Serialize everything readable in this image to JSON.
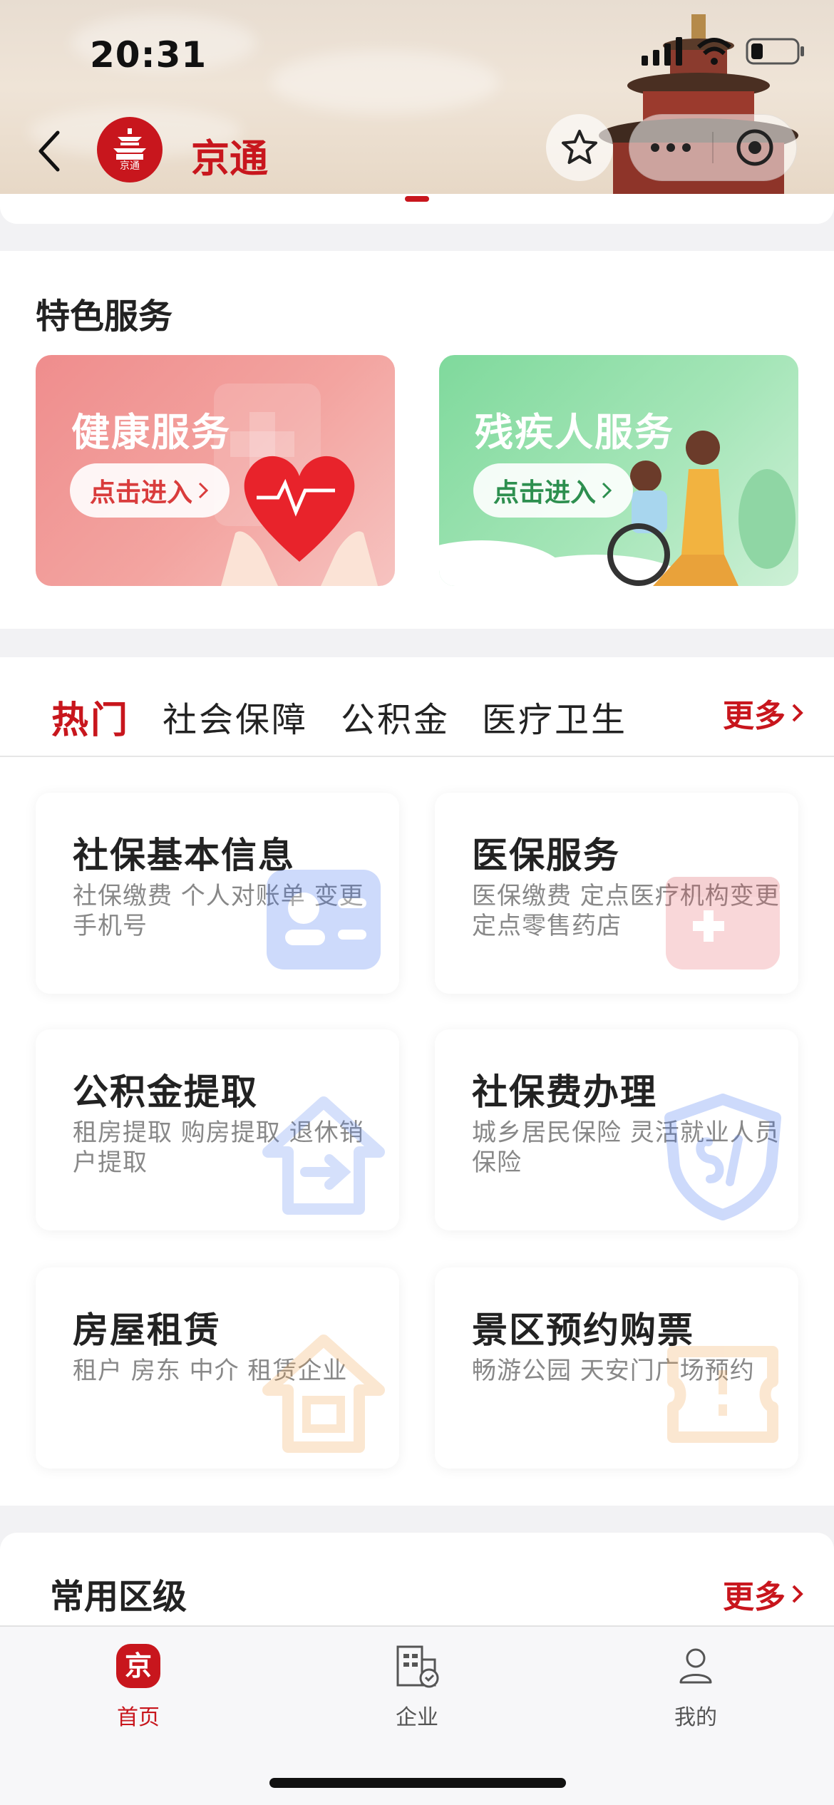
{
  "status_bar": {
    "time": "20:31"
  },
  "header": {
    "app_title": "京通",
    "logo_caption": "京通"
  },
  "featured": {
    "title": "特色服务",
    "cards": [
      {
        "name": "健康服务",
        "button": "点击进入"
      },
      {
        "name": "残疾人服务",
        "button": "点击进入"
      }
    ]
  },
  "tabs": {
    "items": [
      "热门",
      "社会保障",
      "公积金",
      "医疗卫生"
    ],
    "active": "热门",
    "more": "更多"
  },
  "services": [
    {
      "title": "社保基本信息",
      "desc": "社保缴费 个人对账单 变更手机号",
      "icon": "id-card-icon"
    },
    {
      "title": "医保服务",
      "desc": "医保缴费 定点医疗机构变更 定点零售药店",
      "icon": "medical-card-icon"
    },
    {
      "title": "公积金提取",
      "desc": "租房提取 购房提取 退休销户提取",
      "icon": "house-withdraw-icon"
    },
    {
      "title": "社保费办理",
      "desc": "城乡居民保险 灵活就业人员保险",
      "icon": "si-shield-icon"
    },
    {
      "title": "房屋租赁",
      "desc": "租户 房东 中介 租赁企业",
      "icon": "house-icon"
    },
    {
      "title": "景区预约购票",
      "desc": "畅游公园 天安门广场预约",
      "icon": "ticket-icon"
    }
  ],
  "regional": {
    "title": "常用区级",
    "more": "更多"
  },
  "tabbar": {
    "items": [
      {
        "label": "首页",
        "active": true
      },
      {
        "label": "企业",
        "active": false
      },
      {
        "label": "我的",
        "active": false
      }
    ]
  },
  "colors": {
    "accent": "#c8161d",
    "health": "#ef8d8d",
    "disabled_service": "#7fd99c"
  }
}
